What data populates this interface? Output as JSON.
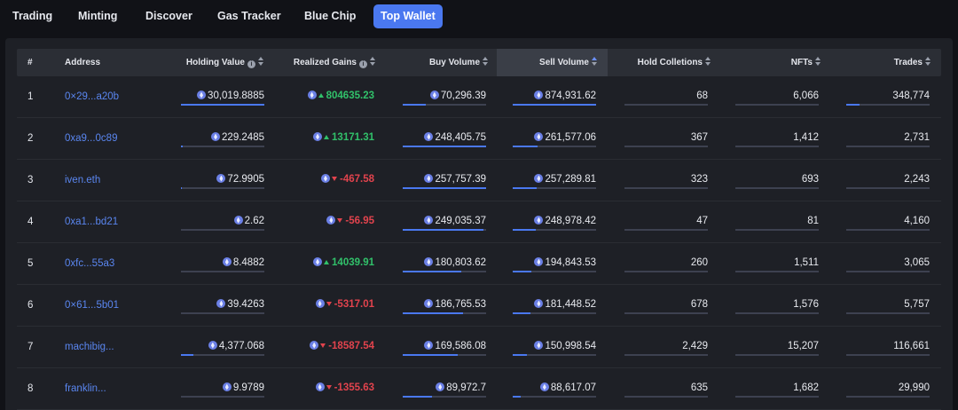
{
  "tabs": [
    {
      "label": "Trading",
      "active": false
    },
    {
      "label": "Minting",
      "active": false
    },
    {
      "label": "Discover",
      "active": false
    },
    {
      "label": "Gas Tracker",
      "active": false
    },
    {
      "label": "Blue Chip",
      "active": false
    },
    {
      "label": "Top Wallet",
      "active": true
    }
  ],
  "columns": {
    "rank": "#",
    "address": "Address",
    "holding_value": "Holding Value",
    "realized_gains": "Realized Gains",
    "buy_volume": "Buy Volume",
    "sell_volume": "Sell Volume",
    "hold_collections": "Hold Colletions",
    "nfts": "NFTs",
    "trades": "Trades"
  },
  "sorted_column": "sell_volume",
  "colors": {
    "accent": "#4a78f0",
    "link": "#5a86f0",
    "gain_up": "#31c16a",
    "gain_down": "#e2434d"
  },
  "rows": [
    {
      "rank": "1",
      "address": "0×29...a20b",
      "holding": "30,019.8885",
      "holding_pct": 1.0,
      "gain": "804635.23",
      "gain_dir": "up",
      "buy": "70,296.39",
      "buy_pct": 0.28,
      "sell": "874,931.62",
      "sell_pct": 1.0,
      "collections": "68",
      "nfts": "6,066",
      "trades": "348,774",
      "trades_pct": 0.16
    },
    {
      "rank": "2",
      "address": "0xa9...0c89",
      "holding": "229.2485",
      "holding_pct": 0.02,
      "gain": "13171.31",
      "gain_dir": "up",
      "buy": "248,405.75",
      "buy_pct": 1.0,
      "sell": "261,577.06",
      "sell_pct": 0.3,
      "collections": "367",
      "nfts": "1,412",
      "trades": "2,731",
      "trades_pct": 0.0
    },
    {
      "rank": "3",
      "address": "iven.eth",
      "holding": "72.9905",
      "holding_pct": 0.01,
      "gain": "-467.58",
      "gain_dir": "down",
      "buy": "257,757.39",
      "buy_pct": 1.0,
      "sell": "257,289.81",
      "sell_pct": 0.29,
      "collections": "323",
      "nfts": "693",
      "trades": "2,243",
      "trades_pct": 0.0
    },
    {
      "rank": "4",
      "address": "0xa1...bd21",
      "holding": "2.62",
      "holding_pct": 0.0,
      "gain": "-56.95",
      "gain_dir": "down",
      "buy": "249,035.37",
      "buy_pct": 0.97,
      "sell": "248,978.42",
      "sell_pct": 0.28,
      "collections": "47",
      "nfts": "81",
      "trades": "4,160",
      "trades_pct": 0.0
    },
    {
      "rank": "5",
      "address": "0xfc...55a3",
      "holding": "8.4882",
      "holding_pct": 0.0,
      "gain": "14039.91",
      "gain_dir": "up",
      "buy": "180,803.62",
      "buy_pct": 0.7,
      "sell": "194,843.53",
      "sell_pct": 0.22,
      "collections": "260",
      "nfts": "1,511",
      "trades": "3,065",
      "trades_pct": 0.0
    },
    {
      "rank": "6",
      "address": "0×61...5b01",
      "holding": "39.4263",
      "holding_pct": 0.0,
      "gain": "-5317.01",
      "gain_dir": "down",
      "buy": "186,765.53",
      "buy_pct": 0.72,
      "sell": "181,448.52",
      "sell_pct": 0.21,
      "collections": "678",
      "nfts": "1,576",
      "trades": "5,757",
      "trades_pct": 0.0
    },
    {
      "rank": "7",
      "address": "machibig...",
      "holding": "4,377.068",
      "holding_pct": 0.15,
      "gain": "-18587.54",
      "gain_dir": "down",
      "buy": "169,586.08",
      "buy_pct": 0.66,
      "sell": "150,998.54",
      "sell_pct": 0.17,
      "collections": "2,429",
      "nfts": "15,207",
      "trades": "116,661",
      "trades_pct": 0.0
    },
    {
      "rank": "8",
      "address": "franklin...",
      "holding": "9.9789",
      "holding_pct": 0.0,
      "gain": "-1355.63",
      "gain_dir": "down",
      "buy": "89,972.7",
      "buy_pct": 0.35,
      "sell": "88,617.07",
      "sell_pct": 0.1,
      "collections": "635",
      "nfts": "1,682",
      "trades": "29,990",
      "trades_pct": 0.0
    }
  ]
}
